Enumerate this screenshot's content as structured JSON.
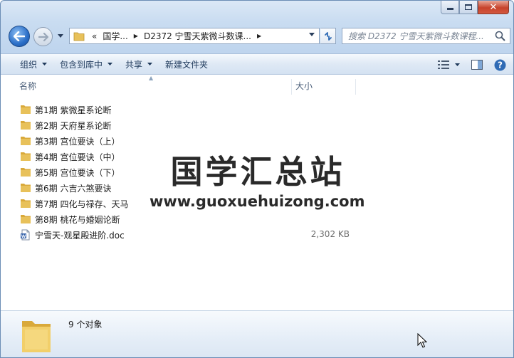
{
  "address": {
    "crumbs": [
      "«",
      "国学...",
      "D2372 宁雪天紫微斗数课..."
    ]
  },
  "search": {
    "placeholder": "搜索 D2372 宁雪天紫微斗数课程..."
  },
  "toolbar": {
    "organize": "组织",
    "include_library": "包含到库中",
    "share": "共享",
    "new_folder": "新建文件夹"
  },
  "columns": {
    "name": "名称",
    "size": "大小"
  },
  "files": [
    {
      "name": "第1期 紫微星系论断",
      "type": "folder",
      "size": ""
    },
    {
      "name": "第2期 天府星系论断",
      "type": "folder",
      "size": ""
    },
    {
      "name": "第3期 宫位要诀（上）",
      "type": "folder",
      "size": ""
    },
    {
      "name": "第4期 宫位要诀（中）",
      "type": "folder",
      "size": ""
    },
    {
      "name": "第5期 宫位要诀（下）",
      "type": "folder",
      "size": ""
    },
    {
      "name": "第6期 六吉六煞要诀",
      "type": "folder",
      "size": ""
    },
    {
      "name": "第7期 四化与禄存、天马",
      "type": "folder",
      "size": ""
    },
    {
      "name": "第8期 桃花与婚姻论断",
      "type": "folder",
      "size": ""
    },
    {
      "name": "宁雪天-观星殿进阶.doc",
      "type": "doc",
      "size": "2,302 KB"
    }
  ],
  "watermark": {
    "title": "国学汇总站",
    "url": "www.guoxuehuizong.com"
  },
  "status": {
    "count": "9 个对象"
  },
  "colors": {
    "folder": "#e8c15a",
    "accent": "#2b6fc8"
  }
}
